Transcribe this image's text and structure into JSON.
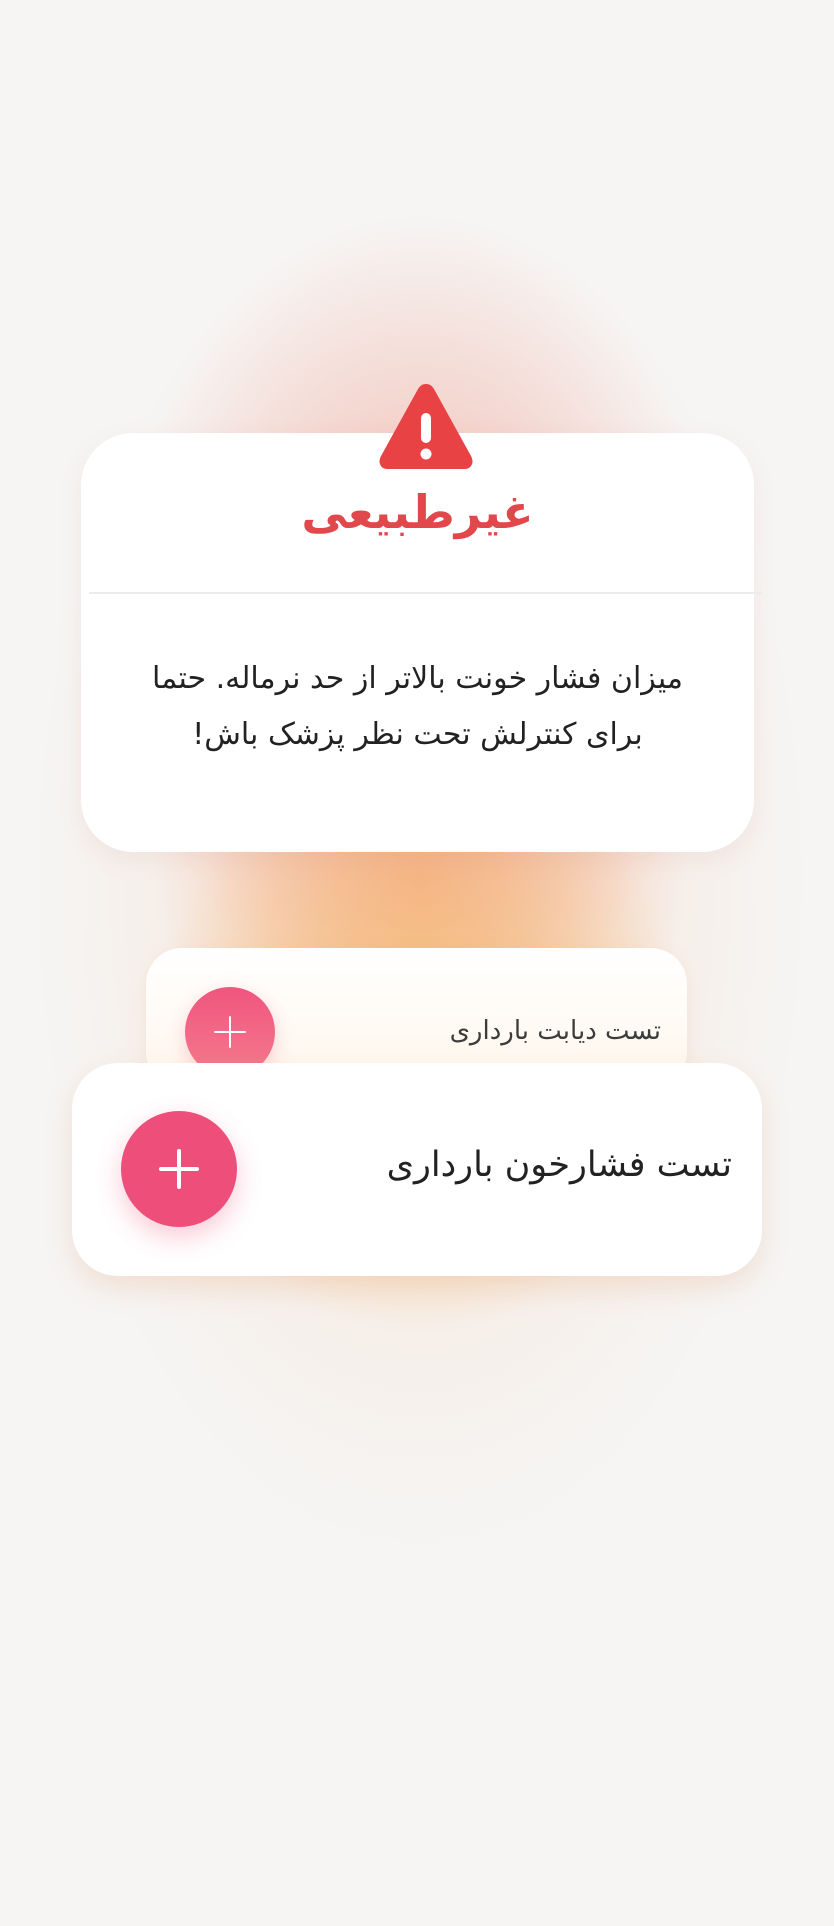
{
  "colors": {
    "alert_red": "#e0484b",
    "button_pink": "#ee4f7a",
    "text_dark": "#222222"
  },
  "alert": {
    "icon": "warning-icon",
    "title": "غیرطبیعی",
    "message": "میزان فشار خونت بالاتر از حد نرماله. حتما برای کنترلش تحت نظر پزشک باش!"
  },
  "tests": [
    {
      "label": "تست دیابت بارداری",
      "action_icon": "plus-icon"
    },
    {
      "label": "تست فشارخون بارداری",
      "action_icon": "plus-icon"
    }
  ]
}
